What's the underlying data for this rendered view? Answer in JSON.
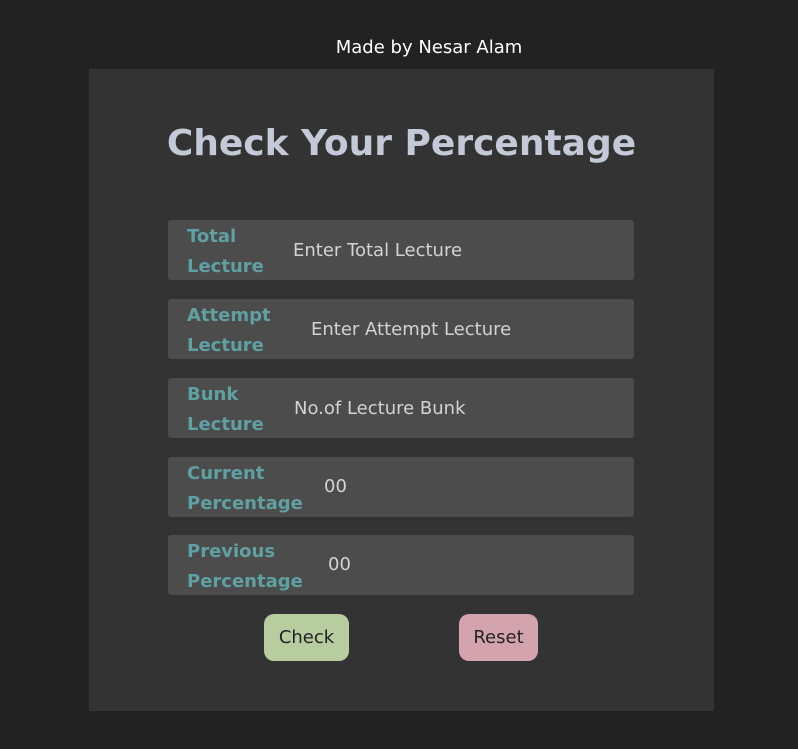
{
  "header": {
    "credit": "Made by Nesar Alam"
  },
  "card": {
    "title": "Check Your Percentage",
    "fields": [
      {
        "label_line1": "Total",
        "label_line2": "Lecture",
        "placeholder": "Enter Total Lecture",
        "value": ""
      },
      {
        "label_line1": "Attempt",
        "label_line2": "Lecture",
        "placeholder": "Enter Attempt Lecture",
        "value": ""
      },
      {
        "label_line1": "Bunk",
        "label_line2": "Lecture",
        "placeholder": "No.of Lecture Bunk",
        "value": ""
      }
    ],
    "results": [
      {
        "label_line1": "Current",
        "label_line2": "Percentage",
        "value": "00"
      },
      {
        "label_line1": "Previous",
        "label_line2": "Percentage",
        "value": "00"
      }
    ],
    "buttons": {
      "check": "Check",
      "reset": "Reset"
    }
  },
  "colors": {
    "page_background": "#222222",
    "card_background": "#333333",
    "row_background": "#4c4c4c",
    "label_color": "#5fa0a3",
    "title_color": "#c3c9d6",
    "check_button": "#b7cc9f",
    "reset_button": "#d3a4ad"
  }
}
